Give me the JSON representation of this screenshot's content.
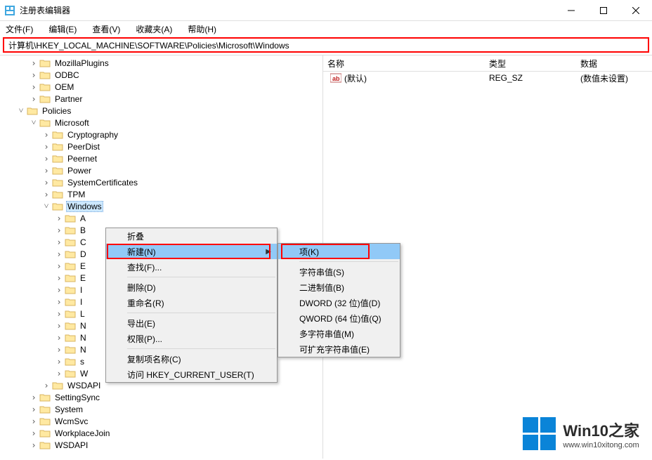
{
  "title": "注册表编辑器",
  "menu": {
    "file": "文件(F)",
    "edit": "编辑(E)",
    "view": "查看(V)",
    "fav": "收藏夹(A)",
    "help": "帮助(H)"
  },
  "address": "计算机\\HKEY_LOCAL_MACHINE\\SOFTWARE\\Policies\\Microsoft\\Windows",
  "columns": {
    "name": "名称",
    "type": "类型",
    "data": "数据"
  },
  "value_row": {
    "name": "(默认)",
    "type": "REG_SZ",
    "data": "(数值未设置)"
  },
  "tree_top": [
    "MozillaPlugins",
    "ODBC",
    "OEM",
    "Partner"
  ],
  "tree_policies": "Policies",
  "tree_microsoft": "Microsoft",
  "tree_ms_pre": [
    "Cryptography",
    "PeerDist",
    "Peernet",
    "Power",
    "SystemCertificates",
    "TPM"
  ],
  "tree_windows": "Windows",
  "tree_win_children_visible": [
    "A",
    "B",
    "C",
    "D",
    "E",
    "E",
    "I",
    "I",
    "L",
    "N",
    "N",
    "N",
    "s",
    "W"
  ],
  "tree_ms_post": [
    "WSDAPI"
  ],
  "tree_after_policies": [
    "SettingSync",
    "System",
    "WcmSvc",
    "WorkplaceJoin",
    "WSDAPI"
  ],
  "ctx": {
    "collapse": "折叠",
    "new": "新建(N)",
    "find": "查找(F)...",
    "delete": "删除(D)",
    "rename": "重命名(R)",
    "export": "导出(E)",
    "perm": "权限(P)...",
    "copykey": "复制项名称(C)",
    "gotohkcu": "访问 HKEY_CURRENT_USER(T)"
  },
  "sub": {
    "key": "项(K)",
    "string": "字符串值(S)",
    "binary": "二进制值(B)",
    "dword": "DWORD (32 位)值(D)",
    "qword": "QWORD (64 位)值(Q)",
    "multi": "多字符串值(M)",
    "expand": "可扩充字符串值(E)"
  },
  "watermark": {
    "brand": "Win10之家",
    "url": "www.win10xitong.com"
  }
}
